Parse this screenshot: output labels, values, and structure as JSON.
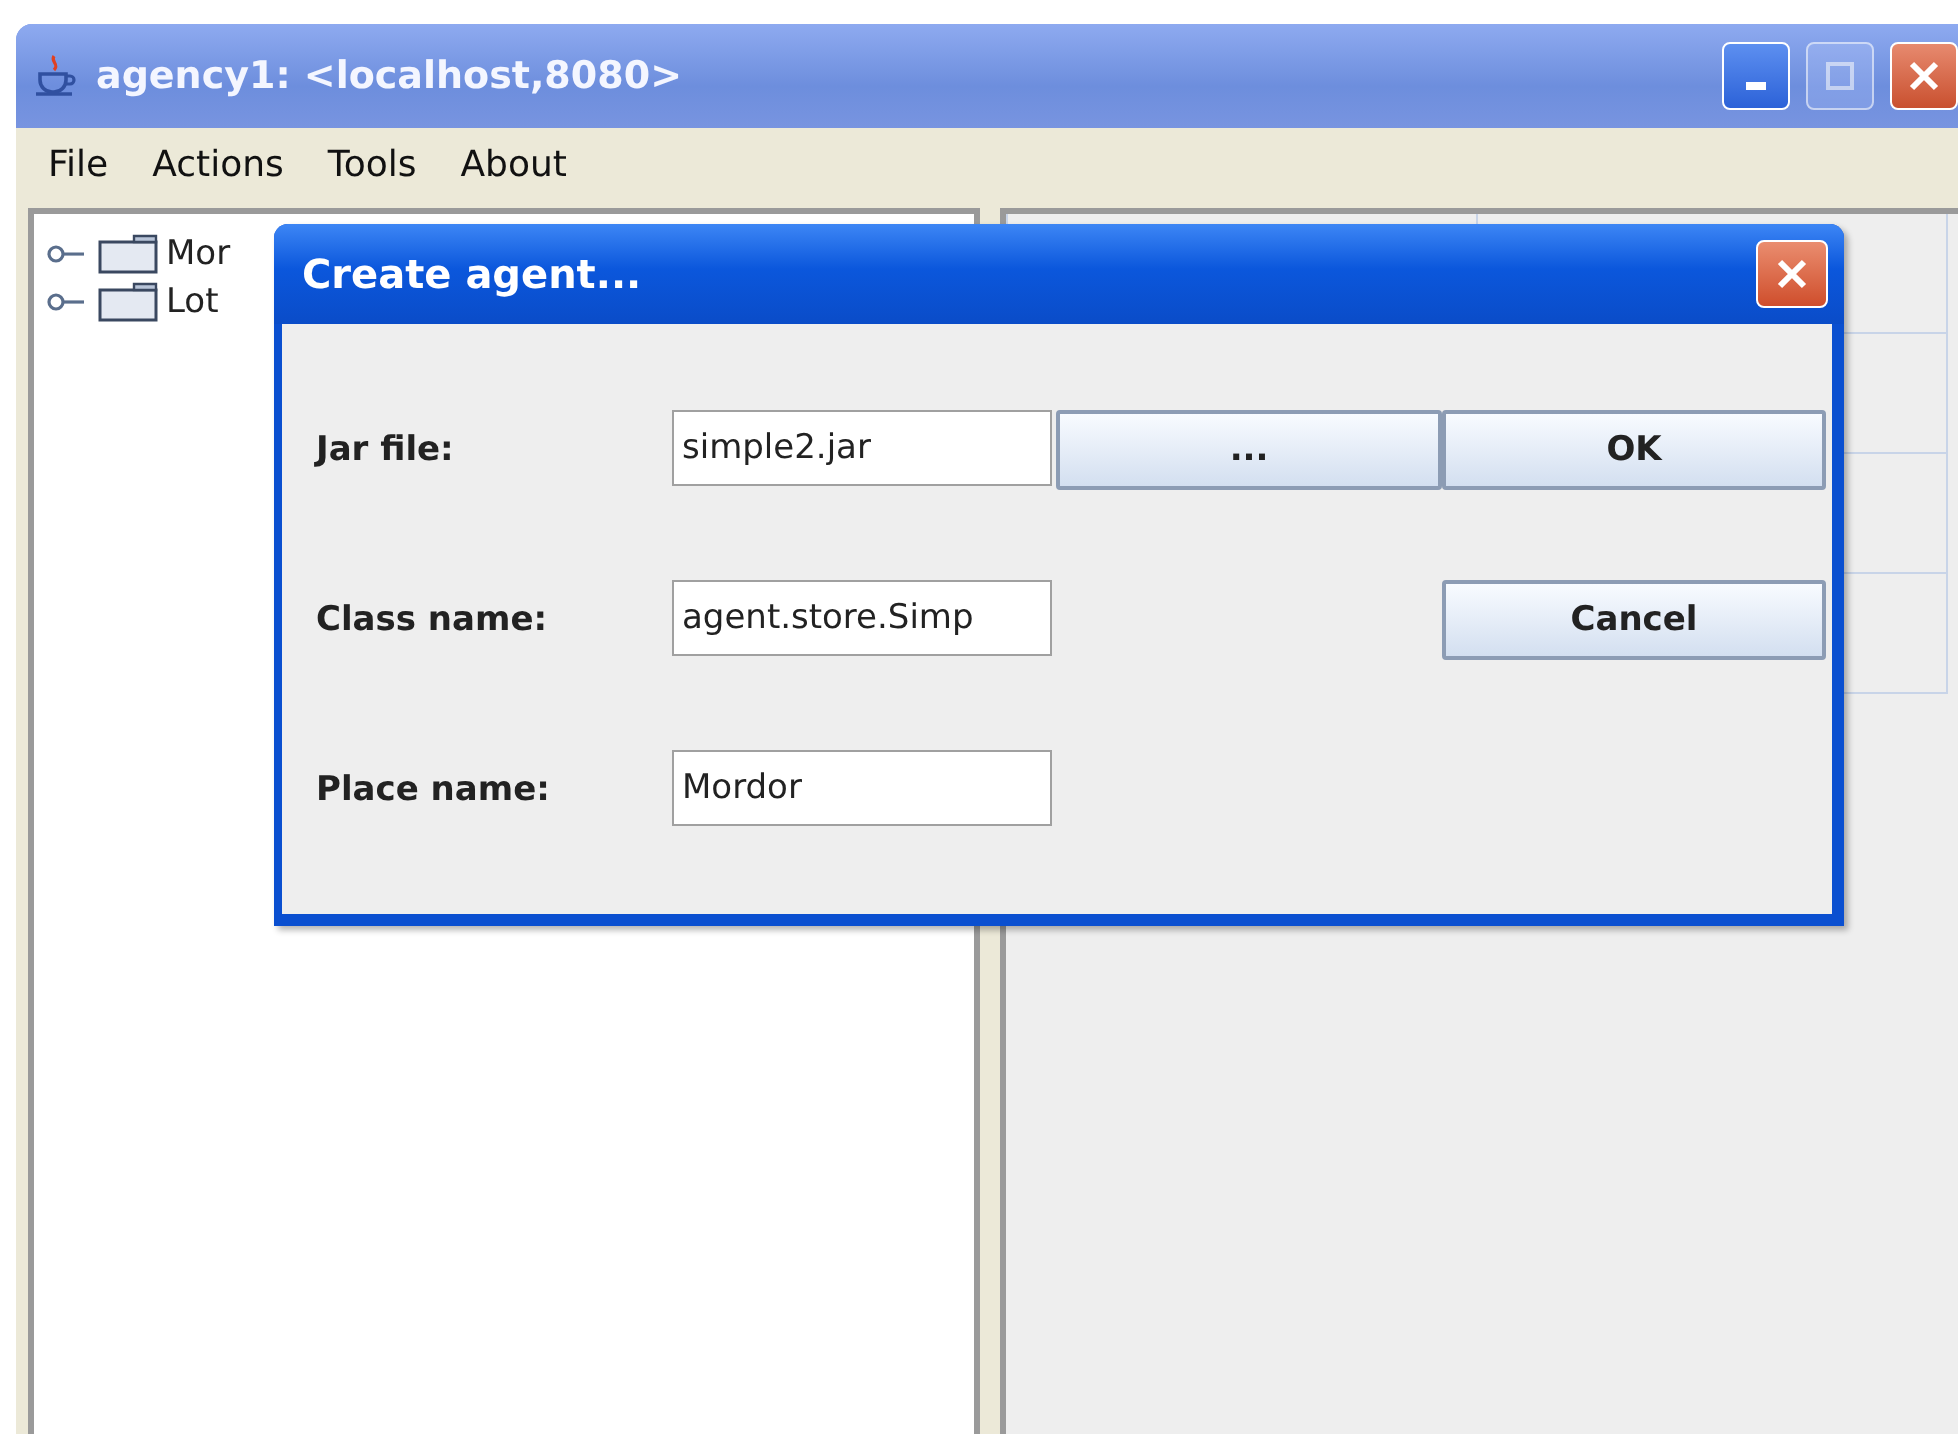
{
  "window": {
    "title": "agency1: <localhost,8080>",
    "controls": [
      {
        "kind": "minimize",
        "disabled": false
      },
      {
        "kind": "maximize",
        "disabled": true
      },
      {
        "kind": "close",
        "disabled": false
      }
    ]
  },
  "menu": [
    "File",
    "Actions",
    "Tools",
    "About"
  ],
  "tree": {
    "items": [
      {
        "label": "Mor"
      },
      {
        "label": "Lot"
      }
    ]
  },
  "dialog": {
    "title": "Create agent...",
    "rows": [
      {
        "label": "Jar file:",
        "value": "simple2.jar",
        "buttons": [
          "...",
          "OK"
        ]
      },
      {
        "label": "Class name:",
        "value": "agent.store.Simp",
        "buttons": [
          "Cancel"
        ]
      },
      {
        "label": "Place name:",
        "value": "Mordor",
        "buttons": []
      }
    ]
  }
}
